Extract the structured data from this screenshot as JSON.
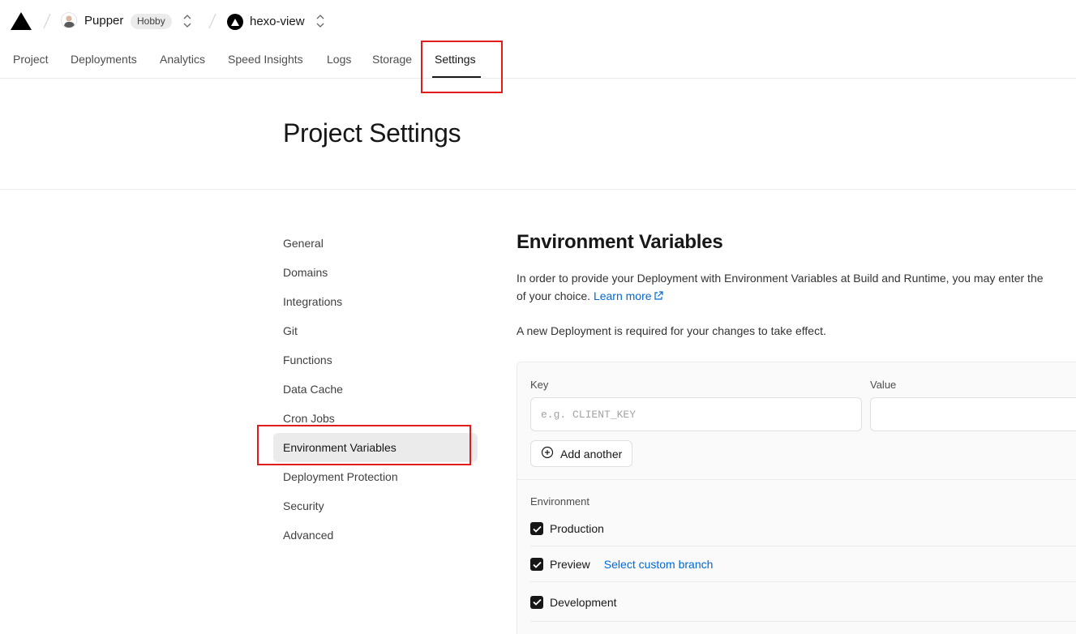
{
  "topbar": {
    "team_name": "Pupper",
    "team_plan": "Hobby",
    "project_name": "hexo-view",
    "logo_icon": "vercel-triangle-icon"
  },
  "tabs": [
    {
      "label": "Project"
    },
    {
      "label": "Deployments"
    },
    {
      "label": "Analytics"
    },
    {
      "label": "Speed Insights"
    },
    {
      "label": "Logs"
    },
    {
      "label": "Storage"
    },
    {
      "label": "Settings",
      "active": true
    }
  ],
  "page": {
    "title": "Project Settings"
  },
  "sidenav": {
    "items": [
      {
        "label": "General"
      },
      {
        "label": "Domains"
      },
      {
        "label": "Integrations"
      },
      {
        "label": "Git"
      },
      {
        "label": "Functions"
      },
      {
        "label": "Data Cache"
      },
      {
        "label": "Cron Jobs"
      },
      {
        "label": "Environment Variables",
        "active": true
      },
      {
        "label": "Deployment Protection"
      },
      {
        "label": "Security"
      },
      {
        "label": "Advanced"
      }
    ]
  },
  "env": {
    "title": "Environment Variables",
    "description_1": "In order to provide your Deployment with Environment Variables at Build and Runtime, you may enter the",
    "description_2": "of your choice.",
    "learn_more": "Learn more",
    "notice": "A new Deployment is required for your changes to take effect.",
    "key_label": "Key",
    "key_placeholder": "e.g. CLIENT_KEY",
    "value_label": "Value",
    "value_value": "",
    "add_another": "Add another",
    "environment_label": "Environment",
    "environments": [
      {
        "label": "Production",
        "checked": true
      },
      {
        "label": "Preview",
        "checked": true
      },
      {
        "label": "Development",
        "checked": true
      }
    ],
    "select_custom_branch": "Select custom branch"
  },
  "colors": {
    "link": "#0068d6",
    "annotation": "#e21b1b",
    "text": "#171717"
  }
}
